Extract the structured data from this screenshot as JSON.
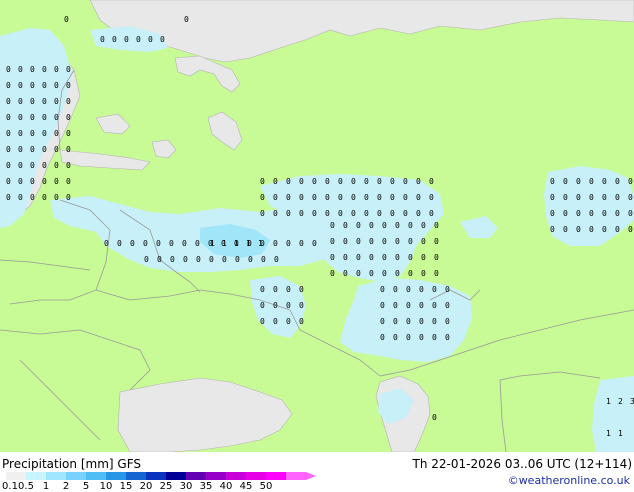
{
  "map": {
    "product": "Precipitation [mm]",
    "model": "GFS",
    "valid_time": "Th 22-01-2026 03..06 UTC (12+114)",
    "credit": "©weatheronline.co.uk",
    "colors": {
      "land": "#c8fa96",
      "sea": "#e8e8e8",
      "precip_light": "#c8f0f8",
      "precip_mid": "#a0e6f8",
      "border": "#9a9a9a"
    },
    "legend": {
      "labels": [
        "0.1",
        "0.5",
        "1",
        "2",
        "5",
        "10",
        "15",
        "20",
        "25",
        "30",
        "35",
        "40",
        "45",
        "50"
      ],
      "colors": [
        "#f0f0f0",
        "#c8f5ff",
        "#a0e6ff",
        "#78d2ff",
        "#50bef5",
        "#2896e6",
        "#1464d2",
        "#0a32be",
        "#000096",
        "#6400b4",
        "#9600c8",
        "#c800dc",
        "#e600e6",
        "#ff00ff",
        "#ff64ff"
      ]
    },
    "values_note": "",
    "amounts": [
      "0",
      "1",
      "2",
      "3"
    ]
  }
}
